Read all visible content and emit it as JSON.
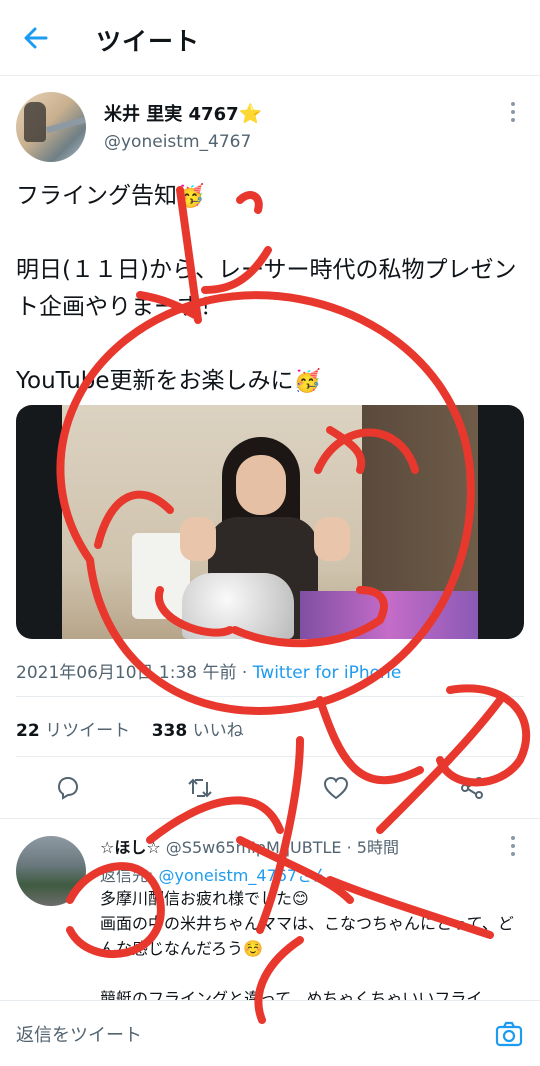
{
  "header": {
    "title": "ツイート",
    "back_icon": "arrow-left-icon"
  },
  "tweet": {
    "author_name": "米井 里実 4767",
    "author_badge": "⭐",
    "author_handle": "@yoneistm_4767",
    "body_line1": "フライング告知",
    "body_line2": "明日(１１日)から、レーサー時代の私物プレゼント企画やりまーす！",
    "body_line3": "YouTube更新をお楽しみに",
    "emoji_party": "🥳",
    "timestamp": "2021年06月10日 1:38 午前",
    "separator": " · ",
    "client": "Twitter for iPhone",
    "retweets_count": "22",
    "retweets_label": "リツイート",
    "likes_count": "338",
    "likes_label": "いいね"
  },
  "actions": [
    "reply-icon",
    "retweet-icon",
    "like-icon",
    "share-icon"
  ],
  "reply": {
    "name": "☆ほし☆",
    "handle": "@S5w65mIpMqUBTLE",
    "time": "5時間",
    "replying_prefix": "返信先: ",
    "replying_to": "@yoneistm_4767さん",
    "text": "多摩川配信お疲れ様でした😊\n画面の中の米井ちゃんママは、こなつちゃんにとって、どんな感じなんだろう☺️\n\n競艇のフライングと違って、めちゃくちゃいいフライ"
  },
  "composer": {
    "placeholder": "返信をツイート",
    "camera_icon": "camera-icon"
  },
  "colors": {
    "accent": "#1d9bf0",
    "scribble": "#e8382e"
  }
}
